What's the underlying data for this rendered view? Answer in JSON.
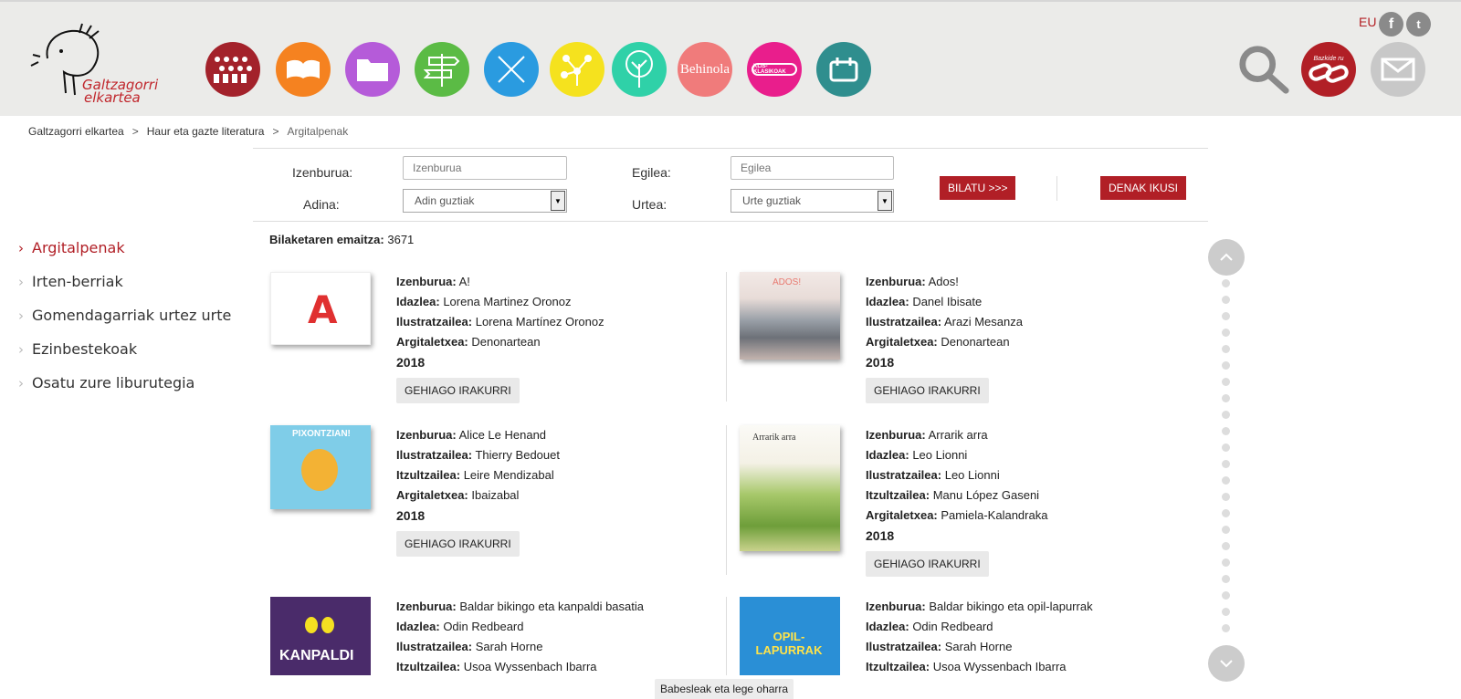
{
  "header": {
    "logo_text_line1": "Galtzagorri",
    "logo_text_line2": "elkartea",
    "language": "EU",
    "nav_circles": [
      {
        "icon": "people-icon",
        "color": "#a3222b"
      },
      {
        "icon": "open-book-icon",
        "color": "#f58220"
      },
      {
        "icon": "folder-icon",
        "color": "#b55bd9"
      },
      {
        "icon": "signpost-icon",
        "color": "#5bbb45"
      },
      {
        "icon": "crossed-pencils-icon",
        "color": "#2a9be0"
      },
      {
        "icon": "network-icon",
        "color": "#f5e21e"
      },
      {
        "icon": "tree-icon",
        "color": "#2fd1a8"
      },
      {
        "icon": "behinola-icon",
        "color": "#f07b7b",
        "label": "Behinola"
      },
      {
        "icon": "klis-klasikoak-icon",
        "color": "#e91e8c",
        "label": "KLIS-KLASIKOAK"
      },
      {
        "icon": "calendar-icon",
        "color": "#2f8e8e"
      }
    ],
    "bookmark_label": "Bazkide ru"
  },
  "breadcrumb": [
    "Galtzagorri elkartea",
    "Haur eta gazte literatura",
    "Argitalpenak"
  ],
  "search": {
    "title_label": "Izenburua:",
    "title_placeholder": "Izenburua",
    "author_label": "Egilea:",
    "author_placeholder": "Egilea",
    "age_label": "Adina:",
    "age_value": "Adin guztiak",
    "year_label": "Urtea:",
    "year_value": "Urte guztiak",
    "search_button": "BILATU >>>",
    "all_button": "DENAK IKUSI"
  },
  "sidebar": {
    "items": [
      {
        "label": "Argitalpenak",
        "active": true
      },
      {
        "label": "Irten-berriak",
        "active": false
      },
      {
        "label": "Gomendagarriak urtez urte",
        "active": false
      },
      {
        "label": "Ezinbestekoak",
        "active": false
      },
      {
        "label": "Osatu zure liburutegia",
        "active": false
      }
    ]
  },
  "results": {
    "count_label": "Bilaketaren emaitza:",
    "count": "3671",
    "more_label": "GEHIAGO IRAKURRI",
    "books": [
      {
        "fields": [
          [
            "Izenburua:",
            "A!"
          ],
          [
            "Idazlea:",
            "Lorena Martinez Oronoz"
          ],
          [
            "Ilustratzailea:",
            "Lorena Martínez Oronoz"
          ],
          [
            "Argitaletxea:",
            "Denonartean"
          ]
        ],
        "year": "2018",
        "cover_text": "A"
      },
      {
        "fields": [
          [
            "Izenburua:",
            "Ados!"
          ],
          [
            "Idazlea:",
            "Danel Ibisate"
          ],
          [
            "Ilustratzailea:",
            "Arazi Mesanza"
          ],
          [
            "Argitaletxea:",
            "Denonartean"
          ]
        ],
        "year": "2018",
        "cover_text": "ADOS!"
      },
      {
        "fields": [
          [
            "Izenburua:",
            "Alice Le Henand"
          ],
          [
            "Ilustratzailea:",
            "Thierry Bedouet"
          ],
          [
            "Itzultzailea:",
            "Leire Mendizabal"
          ],
          [
            "Argitaletxea:",
            "Ibaizabal"
          ]
        ],
        "year": "2018",
        "cover_text": "PIXONTZIAN!"
      },
      {
        "fields": [
          [
            "Izenburua:",
            "Arrarik arra"
          ],
          [
            "Idazlea:",
            "Leo Lionni"
          ],
          [
            "Ilustratzailea:",
            "Leo Lionni"
          ],
          [
            "Itzultzailea:",
            "Manu López Gaseni"
          ],
          [
            "Argitaletxea:",
            "Pamiela-Kalandraka"
          ]
        ],
        "year": "2018",
        "cover_text": "Arrarik arra"
      },
      {
        "fields": [
          [
            "Izenburua:",
            "Baldar bikingo eta kanpaldi basatia"
          ],
          [
            "Idazlea:",
            "Odin Redbeard"
          ],
          [
            "Ilustratzailea:",
            "Sarah Horne"
          ],
          [
            "Itzultzailea:",
            "Usoa Wyssenbach Ibarra"
          ]
        ],
        "year": "",
        "cover_text": "KANPALDI"
      },
      {
        "fields": [
          [
            "Izenburua:",
            "Baldar bikingo eta opil-lapurrak"
          ],
          [
            "Idazlea:",
            "Odin Redbeard"
          ],
          [
            "Ilustratzailea:",
            "Sarah Horne"
          ],
          [
            "Itzultzailea:",
            "Usoa Wyssenbach Ibarra"
          ]
        ],
        "year": "",
        "cover_text": "OPIL-LAPURRAK"
      }
    ]
  },
  "footer": {
    "legal": "Babesleak eta lege oharra"
  }
}
